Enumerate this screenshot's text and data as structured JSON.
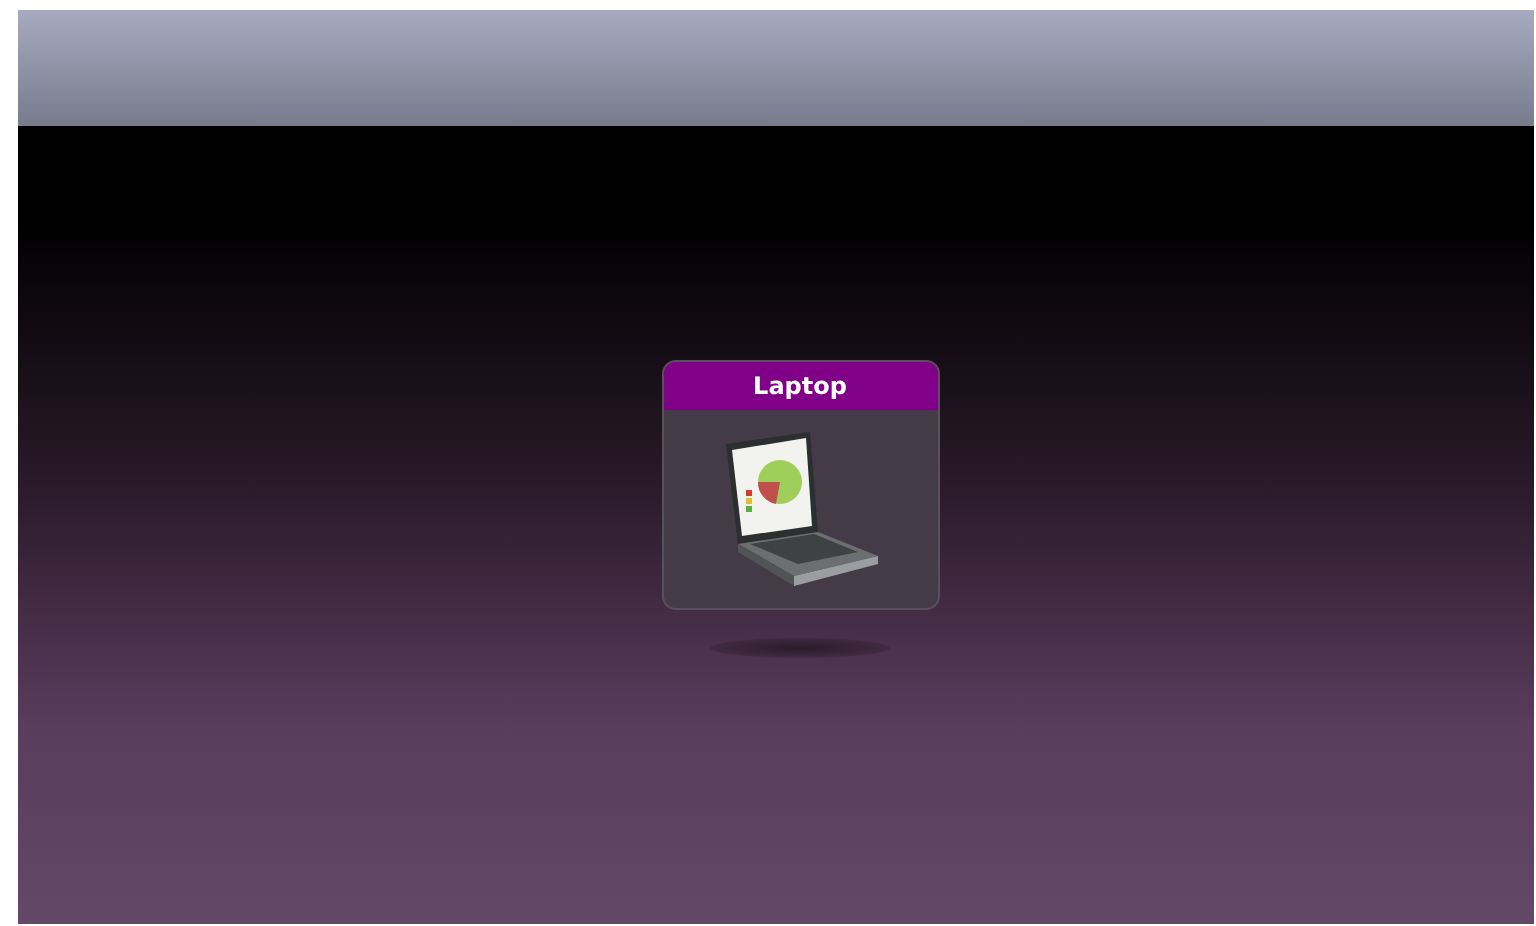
{
  "tile": {
    "label": "Laptop"
  }
}
